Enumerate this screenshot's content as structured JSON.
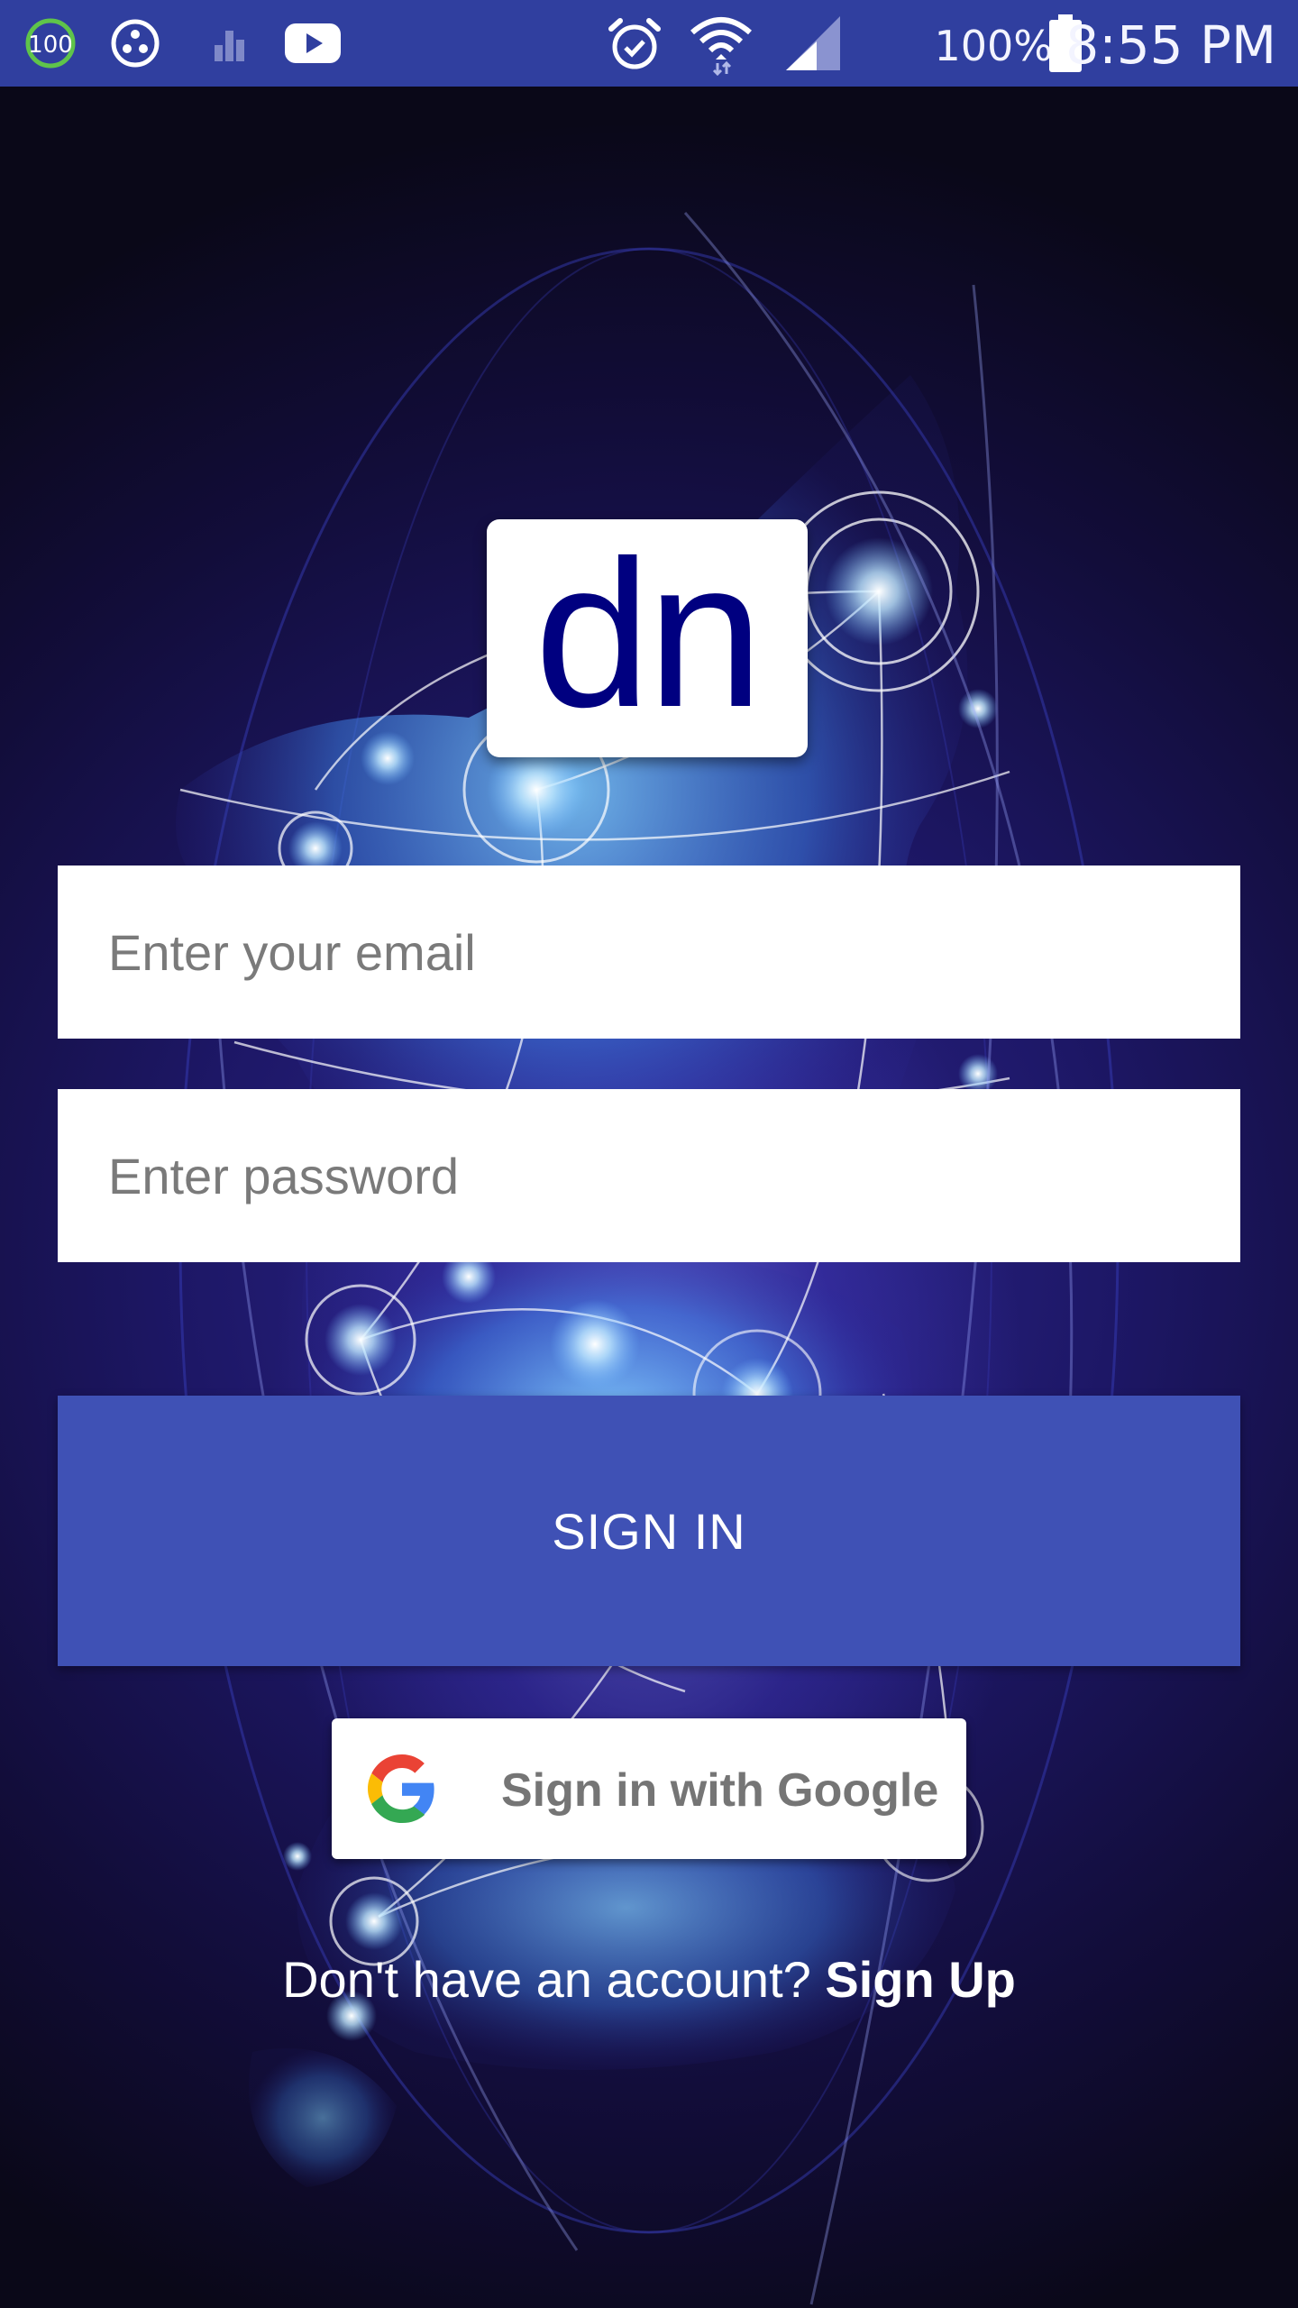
{
  "status_bar": {
    "icons": [
      "score-100-icon",
      "app-badge-icon",
      "bar-chart-icon",
      "youtube-icon",
      "alarm-icon",
      "wifi-icon",
      "cell-signal-icon",
      "battery-icon"
    ],
    "score_badge": "100",
    "battery": "100%",
    "time": "8:55 PM"
  },
  "logo": {
    "text": "dn",
    "color": "#000080"
  },
  "form": {
    "email_placeholder": "Enter your email",
    "password_placeholder": "Enter password",
    "sign_in_label": "SIGN IN",
    "google_label": "Sign in with Google"
  },
  "signup": {
    "prompt": "Don't have an account?",
    "link": "Sign Up"
  },
  "colors": {
    "status_bar": "#303f9f",
    "primary_button": "#3f51b5",
    "background_dark": "#0b0a14",
    "logo_text": "#000080"
  }
}
